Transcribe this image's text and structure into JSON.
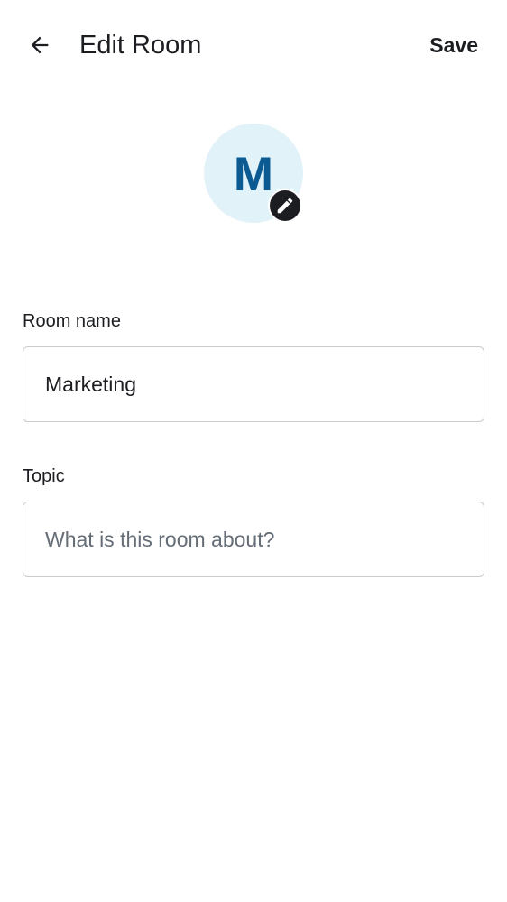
{
  "header": {
    "back_icon": "arrow-left-icon",
    "title": "Edit Room",
    "save_label": "Save"
  },
  "avatar": {
    "letter": "M",
    "background_color": "#e1f2f8",
    "letter_color": "#0c5a92",
    "edit_icon": "pencil-icon"
  },
  "form": {
    "room_name": {
      "label": "Room name",
      "value": "Marketing",
      "placeholder": ""
    },
    "topic": {
      "label": "Topic",
      "value": "",
      "placeholder": "What is this room about?"
    }
  }
}
